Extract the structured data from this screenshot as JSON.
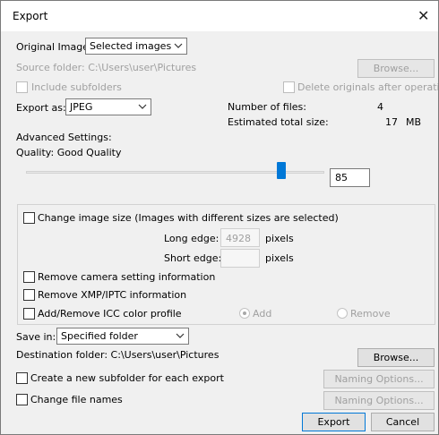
{
  "window": {
    "title": "Export"
  },
  "original_image": {
    "label": "Original Image:",
    "value": "Selected images"
  },
  "source_folder": {
    "label": "Source folder: C:\\Users\\user\\Pictures",
    "browse_label": "Browse..."
  },
  "include_subfolders": {
    "label": "Include subfolders",
    "checked": false
  },
  "delete_originals": {
    "label": "Delete originals after operation",
    "checked": false
  },
  "export_as": {
    "label": "Export as:",
    "value": "JPEG"
  },
  "stats": {
    "files_label": "Number of files:",
    "files_value": "4",
    "size_label": "Estimated total size:",
    "size_value": "17",
    "size_unit": "MB"
  },
  "advanced": {
    "heading": "Advanced Settings:",
    "quality_label": "Quality: Good Quality"
  },
  "quality": {
    "value": "85",
    "level": 85,
    "min": 0,
    "max": 100
  },
  "resize": {
    "label": "Change image size (Images with different sizes are selected)",
    "long_edge_label": "Long edge:",
    "long_edge_value": "4928",
    "long_edge_unit": "pixels",
    "short_edge_label": "Short edge:",
    "short_edge_value": "",
    "short_edge_unit": "pixels"
  },
  "options": {
    "remove_camera": "Remove camera setting information",
    "remove_xmp": "Remove XMP/IPTC information",
    "icc_profile": "Add/Remove ICC color profile",
    "icc_add": "Add",
    "icc_remove": "Remove"
  },
  "save_in": {
    "label": "Save in:",
    "value": "Specified folder"
  },
  "destination": {
    "label": "Destination folder: C:\\Users\\user\\Pictures",
    "browse_label": "Browse..."
  },
  "subfolder": {
    "label": "Create a new subfolder for each export",
    "naming_label": "Naming Options..."
  },
  "change_names": {
    "label": "Change file names",
    "naming_label": "Naming Options..."
  },
  "footer": {
    "export_label": "Export",
    "cancel_label": "Cancel"
  },
  "colors": {
    "accent": "#0078d7",
    "dialog_bg": "#f0f0f0",
    "disabled_text": "#a0a0a0"
  }
}
